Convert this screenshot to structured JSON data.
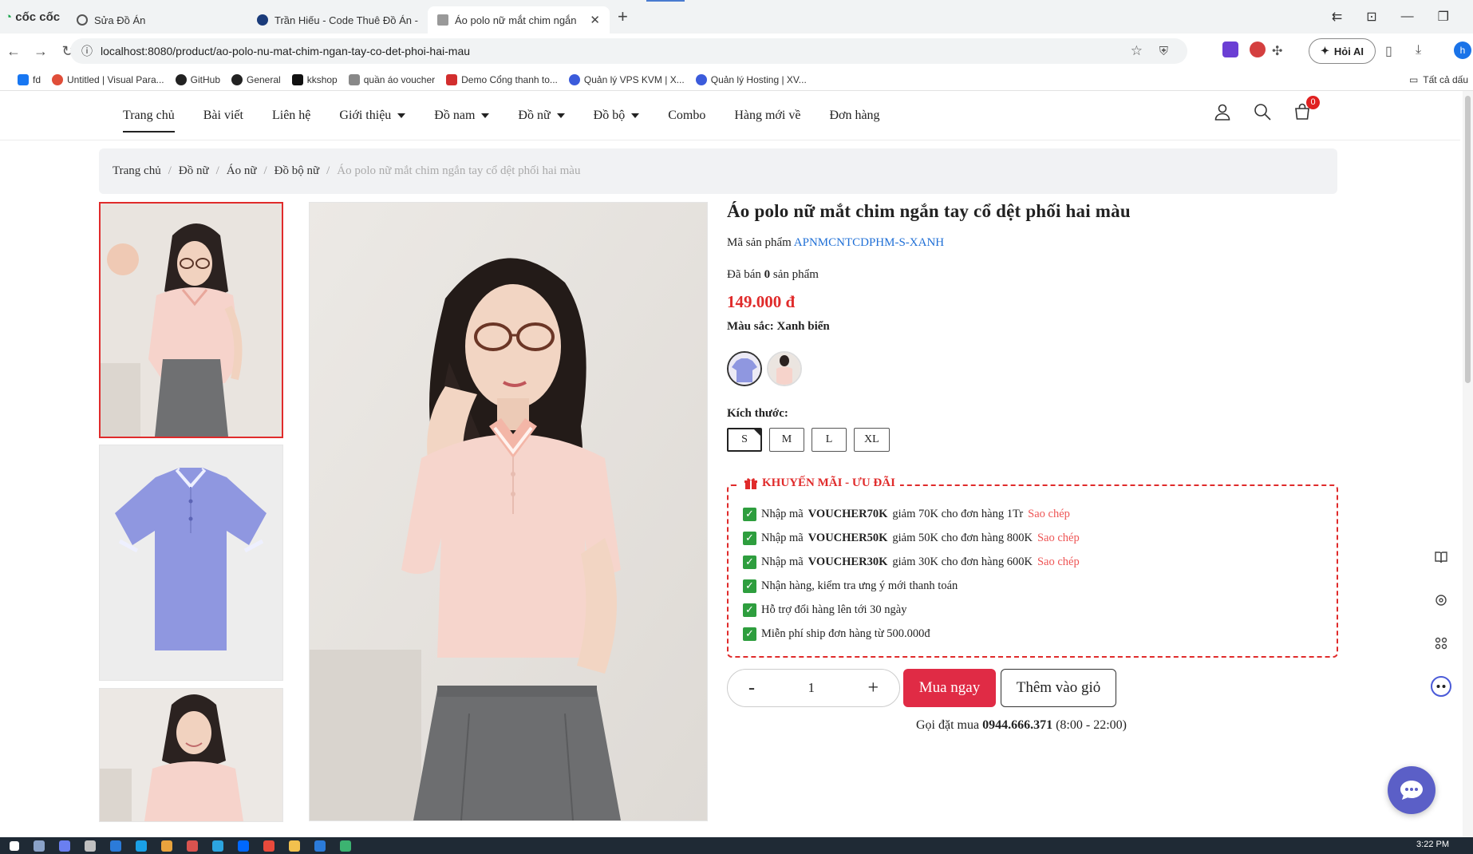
{
  "browser": {
    "brand": "cốc cốc",
    "tabs": [
      {
        "title": "Sửa Đồ Án",
        "active": false
      },
      {
        "title": "Trần Hiếu - Code Thuê Đồ Án - J",
        "active": false
      },
      {
        "title": "Áo polo nữ mắt chim ngắn",
        "active": true
      }
    ],
    "url": "localhost:8080/product/ao-polo-nu-mat-chim-ngan-tay-co-det-phoi-hai-mau",
    "ai_button": "Hỏi AI",
    "profile_initial": "h",
    "bookmarks": [
      {
        "label": "fd",
        "color": "#1877f2"
      },
      {
        "label": "Untitled | Visual Para...",
        "color": "#e04e39"
      },
      {
        "label": "GitHub",
        "color": "#222222"
      },
      {
        "label": "General",
        "color": "#222222"
      },
      {
        "label": "kkshop",
        "color": "#111111"
      },
      {
        "label": "quần áo voucher",
        "color": "#666666"
      },
      {
        "label": "Demo Cổng thanh to...",
        "color": "#d22e2e"
      },
      {
        "label": "Quản lý VPS KVM | X...",
        "color": "#3b5bdb"
      },
      {
        "label": "Quản lý Hosting | XV...",
        "color": "#3b5bdb"
      }
    ],
    "all_bookmarks": "Tất cả dấu"
  },
  "site": {
    "menu": [
      {
        "label": "Trang chủ",
        "dropdown": false,
        "active": true
      },
      {
        "label": "Bài viết",
        "dropdown": false,
        "active": false
      },
      {
        "label": "Liên hệ",
        "dropdown": false,
        "active": false
      },
      {
        "label": "Giới thiệu",
        "dropdown": true,
        "active": false
      },
      {
        "label": "Đồ nam",
        "dropdown": true,
        "active": false
      },
      {
        "label": "Đồ nữ",
        "dropdown": true,
        "active": false
      },
      {
        "label": "Đồ bộ",
        "dropdown": true,
        "active": false
      },
      {
        "label": "Combo",
        "dropdown": false,
        "active": false
      },
      {
        "label": "Hàng mới về",
        "dropdown": false,
        "active": false
      },
      {
        "label": "Đơn hàng",
        "dropdown": false,
        "active": false
      }
    ],
    "cart_count": "0"
  },
  "breadcrumb": [
    "Trang chủ",
    "Đồ nữ",
    "Áo nữ",
    "Đồ bộ nữ",
    "Áo polo nữ mắt chim ngắn tay cổ dệt phối hai màu"
  ],
  "product": {
    "title": "Áo polo nữ mắt chim ngắn tay cổ dệt phối hai màu",
    "sku_label": "Mã sản phẩm",
    "sku": "APNMCNTCDPHM-S-XANH",
    "sold_prefix": "Đã bán",
    "sold_count": "0",
    "sold_suffix": "sản phẩm",
    "price": "149.000 đ",
    "color_label": "Màu sắc:",
    "color_value": "Xanh biển",
    "size_label": "Kích thước:",
    "sizes": [
      "S",
      "M",
      "L",
      "XL"
    ],
    "selected_size": "S"
  },
  "promo": {
    "heading": "KHUYẾN MÃI - ƯU ĐÃI",
    "vouchers": [
      {
        "pre": "Nhập mã",
        "code": "VOUCHER70K",
        "post": "giảm 70K cho đơn hàng 1Tr",
        "copy": "Sao chép"
      },
      {
        "pre": "Nhập mã",
        "code": "VOUCHER50K",
        "post": "giảm 50K cho đơn hàng 800K",
        "copy": "Sao chép"
      },
      {
        "pre": "Nhập mã",
        "code": "VOUCHER30K",
        "post": "giảm 30K cho đơn hàng 600K",
        "copy": "Sao chép"
      }
    ],
    "perks": [
      "Nhận hàng, kiểm tra ưng ý mới thanh toán",
      "Hỗ trợ đổi hàng lên tới 30 ngày",
      "Miễn phí ship đơn hàng từ 500.000đ"
    ]
  },
  "purchase": {
    "minus": "-",
    "qty": "1",
    "plus": "+",
    "buy_now": "Mua ngay",
    "add_to_cart": "Thêm vào giỏ",
    "hotline_prefix": "Gọi đặt mua",
    "hotline": "0944.666.371",
    "hours": "(8:00 - 22:00)"
  },
  "taskbar": {
    "clock": "3:22 PM"
  },
  "colors": {
    "accent_red": "#e02b2b",
    "buy_button": "#e02b45",
    "sku_blue": "#1f6fd6",
    "chat_purple": "#5b5fc7"
  }
}
